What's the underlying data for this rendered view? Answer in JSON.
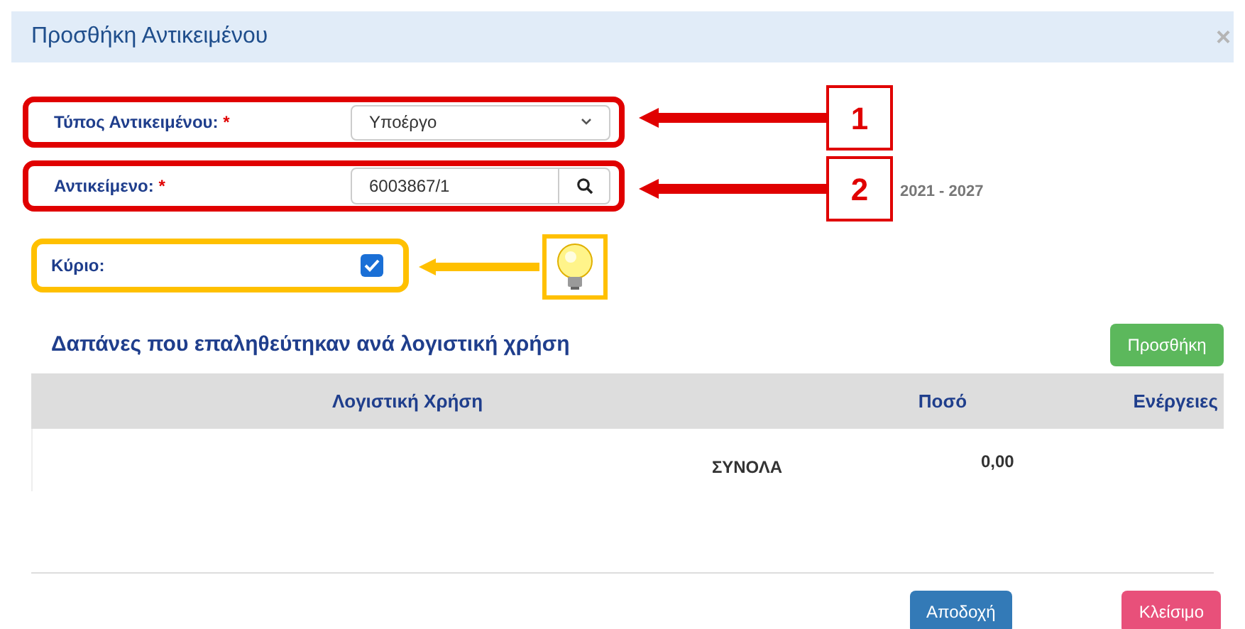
{
  "dialog": {
    "title": "Προσθήκη Αντικειμένου",
    "close": "×"
  },
  "fields": [
    {
      "kind": "select",
      "label": "Τύπος Αντικειμένου:",
      "required": "*",
      "value": "Υποέργο"
    },
    {
      "kind": "lookup",
      "label": "Αντικείμενο:",
      "required": "*",
      "value": "6003867/1"
    },
    {
      "kind": "checkbox",
      "label": "Κύριο:",
      "checked": true
    }
  ],
  "period": "2021 - 2027",
  "callouts": [
    {
      "kind": "number",
      "label": "1"
    },
    {
      "kind": "number",
      "label": "2"
    },
    {
      "kind": "tip"
    }
  ],
  "section": {
    "title": "Δαπάνες που επαληθεύτηκαν ανά λογιστική χρήση",
    "add_button": "Προσθήκη"
  },
  "table": {
    "columns": [
      "Λογιστική Χρήση",
      "Ποσό",
      "Ενέργειες"
    ],
    "totals": {
      "label": "ΣΥΝΟΛΑ",
      "amount": "0,00"
    }
  },
  "footer": {
    "buttons": [
      "Αποδοχή",
      "Κλείσιμο"
    ]
  }
}
